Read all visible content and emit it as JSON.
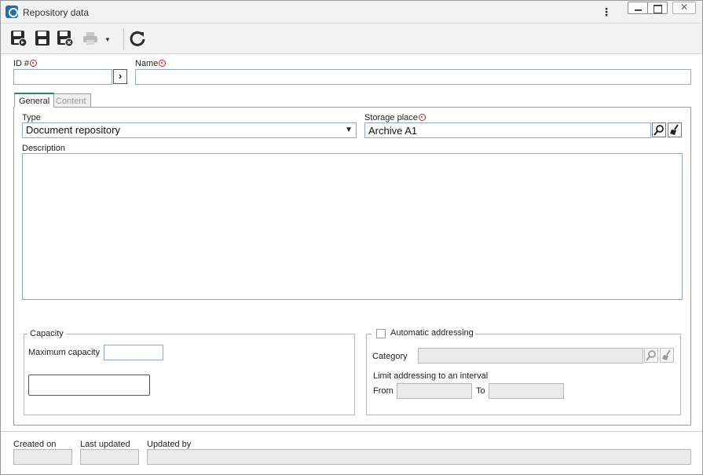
{
  "window": {
    "title": "Repository data"
  },
  "toolbar": {
    "items": [
      "save-and-new-icon",
      "save-icon",
      "save-and-close-icon",
      "print-icon",
      "refresh-icon"
    ]
  },
  "header": {
    "id_label": "ID #",
    "id_value": "",
    "name_label": "Name",
    "name_value": ""
  },
  "tabs": [
    {
      "label": "General",
      "active": true
    },
    {
      "label": "Content",
      "active": false
    }
  ],
  "general": {
    "type_label": "Type",
    "type_value": "Document repository",
    "storage_label": "Storage place",
    "storage_value": "Archive A1",
    "description_label": "Description",
    "description_value": ""
  },
  "capacity": {
    "legend": "Capacity",
    "max_label": "Maximum capacity",
    "max_value": ""
  },
  "auto_addressing": {
    "label": "Automatic addressing",
    "checked": false,
    "category_label": "Category",
    "category_value": "",
    "limit_label": "Limit addressing to an interval",
    "from_label": "From",
    "to_label": "To"
  },
  "footer": {
    "created_on_label": "Created on",
    "last_updated_label": "Last updated",
    "updated_by_label": "Updated by"
  },
  "colors": {
    "required_marker": "#d42020",
    "field_border": "#8fa9c6",
    "tab_accent": "#2c8c4a"
  }
}
